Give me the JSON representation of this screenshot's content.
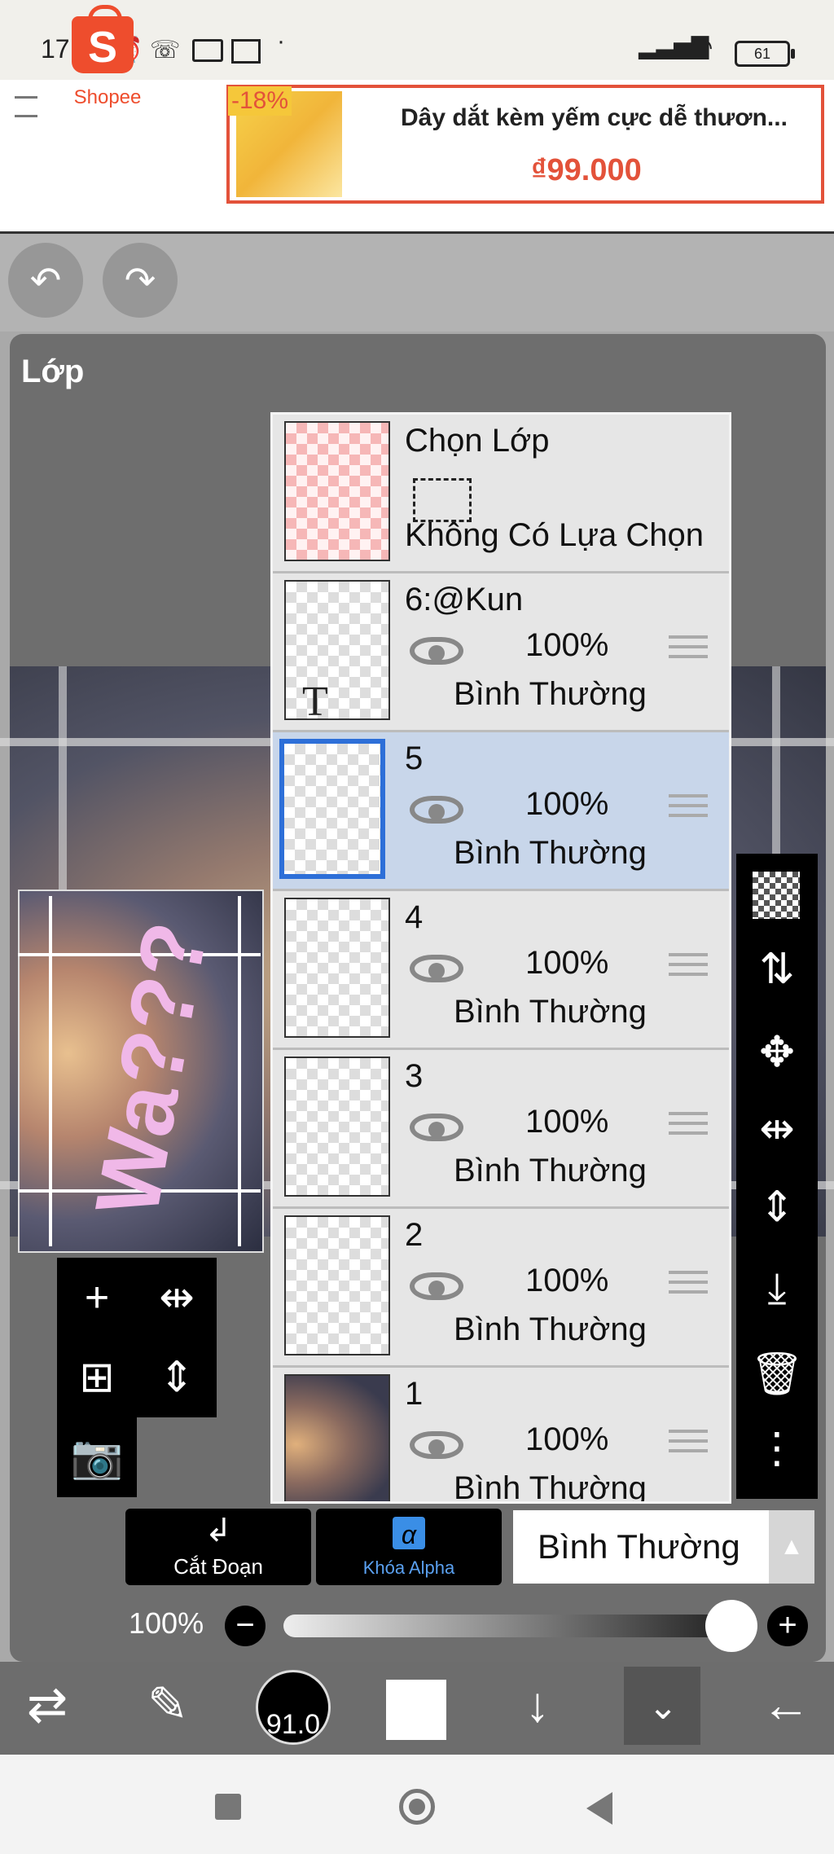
{
  "status_bar": {
    "time": "17:39",
    "battery": "61"
  },
  "ad": {
    "brand": "Shopee",
    "discount": "-18%",
    "title": "Dây dắt kèm yếm cực dễ thươn...",
    "price": "₫99.000"
  },
  "panel": {
    "title": "Lớp"
  },
  "selection_row": {
    "title": "Chọn Lớp",
    "status": "Không Có Lựa Chọn"
  },
  "layers": [
    {
      "name": "6:@Kun",
      "opacity": "100%",
      "blend": "Bình Thường"
    },
    {
      "name": "5",
      "opacity": "100%",
      "blend": "Bình Thường"
    },
    {
      "name": "4",
      "opacity": "100%",
      "blend": "Bình Thường"
    },
    {
      "name": "3",
      "opacity": "100%",
      "blend": "Bình Thường"
    },
    {
      "name": "2",
      "opacity": "100%",
      "blend": "Bình Thường"
    },
    {
      "name": "1",
      "opacity": "100%",
      "blend": "Bình Thường"
    }
  ],
  "canvas": {
    "art_text": "Wa???"
  },
  "controls": {
    "clipping_label": "Cắt Đoạn",
    "alpha_lock_label": "Khóa Alpha",
    "blend_mode": "Bình Thường",
    "opacity_label": "100%"
  },
  "bottom_toolbar": {
    "brush_size": "91.0"
  },
  "icons": {
    "undo": "undo-icon",
    "redo": "redo-icon",
    "eye": "eye-icon",
    "handle": "drag-handle-icon"
  },
  "colors": {
    "shopee": "#ee4d2d",
    "selected_layer": "#c8d6ea",
    "selection_border": "#2d6fd8",
    "alpha_lock_accent": "#3a8ee6"
  }
}
